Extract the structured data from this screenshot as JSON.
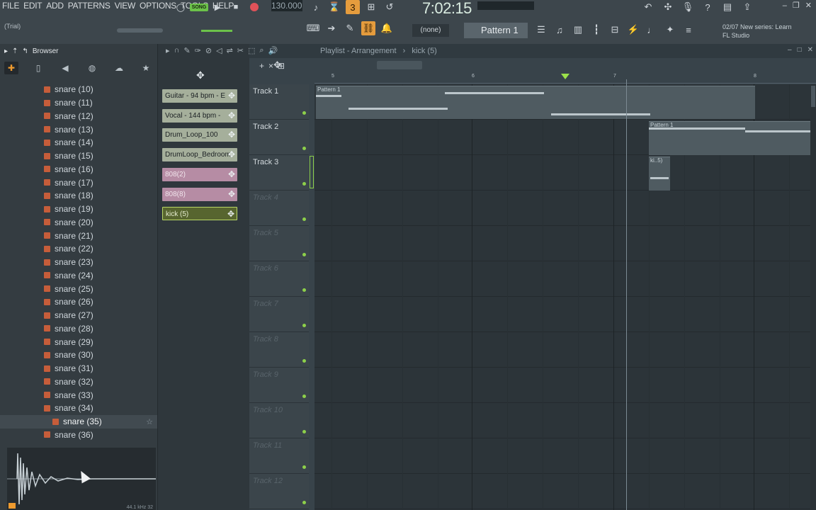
{
  "menu": [
    "FILE",
    "EDIT",
    "ADD",
    "PATTERNS",
    "VIEW",
    "OPTIONS",
    "TOOLS",
    "HELP"
  ],
  "hint": "(Trial)",
  "transport": {
    "mode": "SONG",
    "tempo": "130.000"
  },
  "time_display": "7:02:15",
  "snap": "(none)",
  "pattern_name": "Pattern 1",
  "news": {
    "line1": "02/07  New series: Learn",
    "line2": "FL Studio"
  },
  "browser": {
    "title": "Browser",
    "files": [
      "snare (10)",
      "snare (11)",
      "snare (12)",
      "snare (13)",
      "snare (14)",
      "snare (15)",
      "snare (16)",
      "snare (17)",
      "snare (18)",
      "snare (19)",
      "snare (20)",
      "snare (21)",
      "snare (22)",
      "snare (23)",
      "snare (24)",
      "snare (25)",
      "snare (26)",
      "snare (27)",
      "snare (28)",
      "snare (29)",
      "snare (30)",
      "snare (31)",
      "snare (32)",
      "snare (33)",
      "snare (34)",
      "snare (35)",
      "snare (36)"
    ],
    "hovered_index": 25,
    "waveform_info": "44.1 kHz 32"
  },
  "picker": {
    "clips": [
      {
        "label": "Guitar - 94 bpm - E",
        "kind": "audio"
      },
      {
        "label": "Vocal - 144 bpm -",
        "kind": "audio"
      },
      {
        "label": "Drum_Loop_100",
        "kind": "audio"
      },
      {
        "label": "DrumLoop_Bedroom",
        "kind": "audio"
      },
      {
        "label": "808(2)",
        "kind": "pattern"
      },
      {
        "label": "808(8)",
        "kind": "pattern"
      },
      {
        "label": "kick (5)",
        "kind": "selected"
      }
    ]
  },
  "playlist": {
    "title": "Playlist - Arrangement",
    "current_clip": "kick (5)",
    "bar_numbers": [
      "5",
      "6",
      "7",
      "8"
    ],
    "tracks": [
      "Track 1",
      "Track 2",
      "Track 3",
      "Track 4",
      "Track 5",
      "Track 6",
      "Track 7",
      "Track 8",
      "Track 9",
      "Track 10",
      "Track 11",
      "Track 12"
    ],
    "clip_labels": {
      "track1": "Pattern 1",
      "track2": "Pattern 1",
      "track3": "ki..5)"
    }
  },
  "colors": {
    "accent_orange": "#ef9b2f",
    "accent_green": "#8dd04a",
    "record_red": "#e05259"
  }
}
